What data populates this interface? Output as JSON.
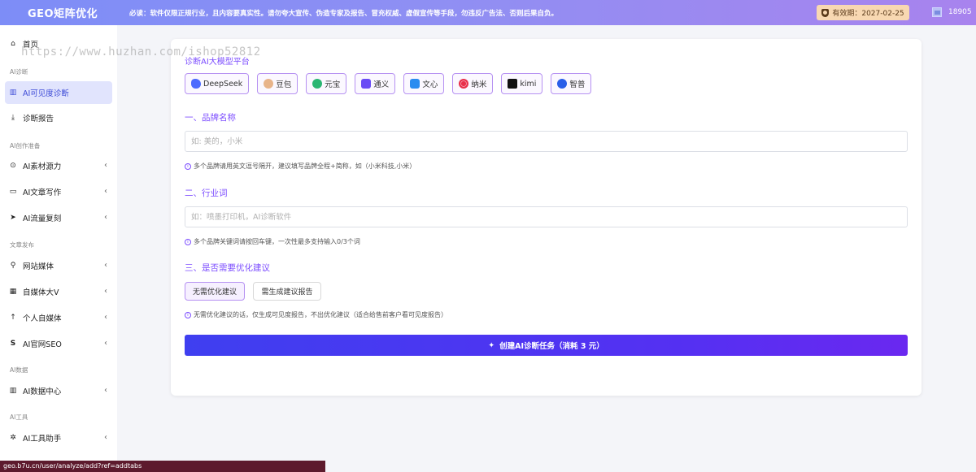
{
  "topbar": {
    "logo": "GEO矩阵优化",
    "notice": "必读：软件仅限正规行业，且内容要真实性。请勿夸大宣传、伪造专家及报告、冒充权威、虚假宣传等手段，勿违反广告法、否则后果自负。",
    "expire_label": "有效期：2027-02-25",
    "user_id": "18905"
  },
  "sidebar": {
    "home": "首页",
    "group_diag": "AI诊断",
    "visibility": "AI可见度诊断",
    "report": "诊断报告",
    "group_create": "AI创作准备",
    "material": "AI素材源力",
    "writing": "AI文章写作",
    "traffic": "AI流量复刻",
    "group_publish": "文章发布",
    "site_media": "网站媒体",
    "self_media": "自媒体大V",
    "personal": "个人自媒体",
    "seo": "AI官网SEO",
    "group_data": "AI数据",
    "data_center": "AI数据中心",
    "group_tools": "AI工具",
    "tool_assistant": "AI工具助手"
  },
  "main": {
    "platform_title": "诊断AI大模型平台",
    "platforms": [
      "DeepSeek",
      "豆包",
      "元宝",
      "通义",
      "文心",
      "纳米",
      "kimi",
      "智普"
    ],
    "sec1_title": "一、品牌名称",
    "brand_placeholder": "如: 美的，小米",
    "brand_hint": "多个品牌请用英文逗号隔开，建议填写品牌全程+简称，如（小米科技,小米）",
    "sec2_title": "二、行业词",
    "industry_placeholder": "如：喷墨打印机，AI诊断软件",
    "industry_hint": "多个品牌关键词请按回车键，一次性最多支持输入0/3个词",
    "sec3_title": "三、是否需要优化建议",
    "opt_no": "无需优化建议",
    "opt_yes": "需生成建议报告",
    "opt_hint": "无需优化建议的话，仅生成可见度报告，不出优化建议（适合给售前客户看可见度报告）",
    "submit": "创建AI诊断任务（消耗  3 元）"
  },
  "watermark": "https://www.huzhan.com/ishop52812",
  "statusbar": "geo.b7u.cn/user/analyze/add?ref=addtabs",
  "colors": {
    "accent": "#7c4dff",
    "topbar_start": "#7d8df7",
    "topbar_end": "#a883ee",
    "submit": "#4a36f1"
  }
}
